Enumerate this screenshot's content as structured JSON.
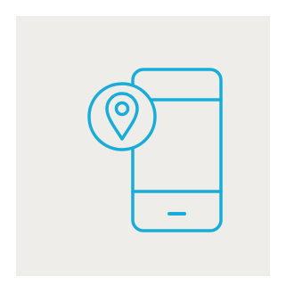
{
  "illustration": {
    "icon": "mobile-location-icon",
    "parts": [
      "smartphone-icon",
      "map-pin-icon"
    ]
  },
  "colors": {
    "background": "#efedea",
    "stroke": "#18acd8"
  }
}
